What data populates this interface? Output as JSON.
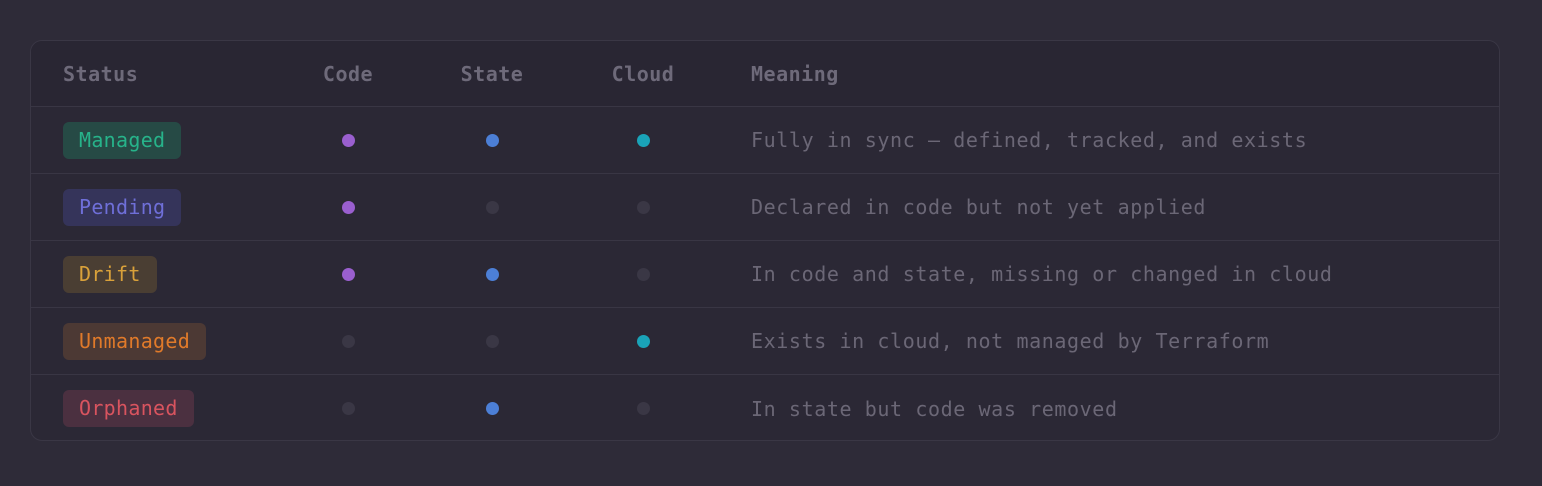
{
  "table": {
    "headers": {
      "status": "Status",
      "code": "Code",
      "state": "State",
      "cloud": "Cloud",
      "meaning": "Meaning"
    },
    "rows": [
      {
        "status": "Managed",
        "code": true,
        "state": true,
        "cloud": true,
        "meaning": "Fully in sync — defined, tracked, and exists",
        "badge_text_color": "#27b38a",
        "badge_bg_color": "#264a45"
      },
      {
        "status": "Pending",
        "code": true,
        "state": false,
        "cloud": false,
        "meaning": "Declared in code but not yet applied",
        "badge_text_color": "#6f6fd8",
        "badge_bg_color": "#35345a"
      },
      {
        "status": "Drift",
        "code": true,
        "state": true,
        "cloud": false,
        "meaning": "In code and state, missing or changed in cloud",
        "badge_text_color": "#d9a13a",
        "badge_bg_color": "#4a3e33"
      },
      {
        "status": "Unmanaged",
        "code": false,
        "state": false,
        "cloud": true,
        "meaning": "Exists in cloud, not managed by Terraform",
        "badge_text_color": "#e07a2a",
        "badge_bg_color": "#4c3934"
      },
      {
        "status": "Orphaned",
        "code": false,
        "state": true,
        "cloud": false,
        "meaning": "In state but code was removed",
        "badge_text_color": "#d9545f",
        "badge_bg_color": "#4b3040"
      }
    ]
  },
  "colors": {
    "code_dot": "#9a5fcf",
    "state_dot": "#4c7fd6",
    "cloud_dot": "#1aa3b8",
    "inactive_dot": "#3a3745"
  }
}
